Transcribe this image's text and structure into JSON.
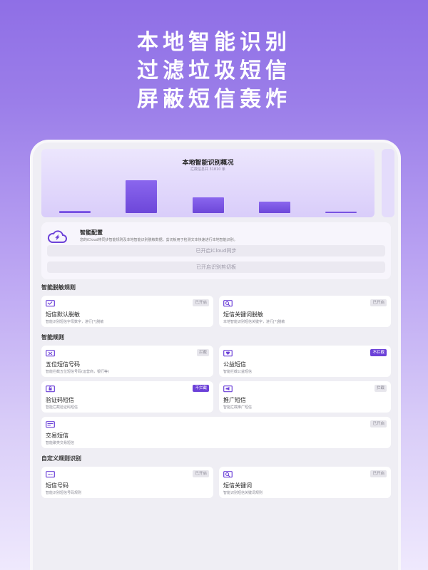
{
  "headline": [
    "本地智能识别",
    "过滤垃圾短信",
    "屏蔽短信轰炸"
  ],
  "chart": {
    "title": "本地智能识别概况",
    "subtitle": "拦截信息共 31810 条"
  },
  "chart_data": {
    "type": "bar",
    "title": "本地智能识别概况",
    "values": [
      3,
      45,
      22,
      16,
      2
    ]
  },
  "config": {
    "title": "智能配置",
    "desc": "您的iCloud将同步智能规则及本地智能识别脱敏数据。剪切板用于检测文本快速进行本地智能识别。",
    "btn1": "已开启iCloud同步",
    "btn2": "已开启识别剪切板"
  },
  "sections": {
    "desensitize": "智能脱敏规则",
    "smart": "智能规则",
    "custom": "自定义规则识别"
  },
  "cards": {
    "default_desensitize": {
      "title": "短信默认脱敏",
      "desc": "智能识别短信字母数字，进行[*]脱敏",
      "badge": "已开启"
    },
    "keyword_desensitize": {
      "title": "短信关键词脱敏",
      "desc": "本地智能识别短信关键字，进行[*]脱敏",
      "badge": "已开启"
    },
    "five_digit": {
      "title": "五位短信号码",
      "desc": "智能拦截五位短信号码(运营商，银行等)",
      "badge": "拦截"
    },
    "public_welfare": {
      "title": "公益短信",
      "desc": "智能拦截公益短信",
      "badge": "不拦截"
    },
    "verification": {
      "title": "验证码短信",
      "desc": "智能拦截验证码短信",
      "badge": "不拦截"
    },
    "promotion": {
      "title": "推广短信",
      "desc": "智能拦截推广短信",
      "badge": "拦截"
    },
    "transaction": {
      "title": "交易短信",
      "desc": "智能聚类交易短信",
      "badge": "已开启"
    },
    "sms_number": {
      "title": "短信号码",
      "desc": "智能识别短信号码规则",
      "badge": "已开启"
    },
    "sms_keyword": {
      "title": "短信关键词",
      "desc": "智能识别短信关键词规则",
      "badge": "已开启"
    }
  },
  "colors": {
    "accent": "#6c41d8",
    "badge_inactive_bg": "#e7e6ec"
  }
}
